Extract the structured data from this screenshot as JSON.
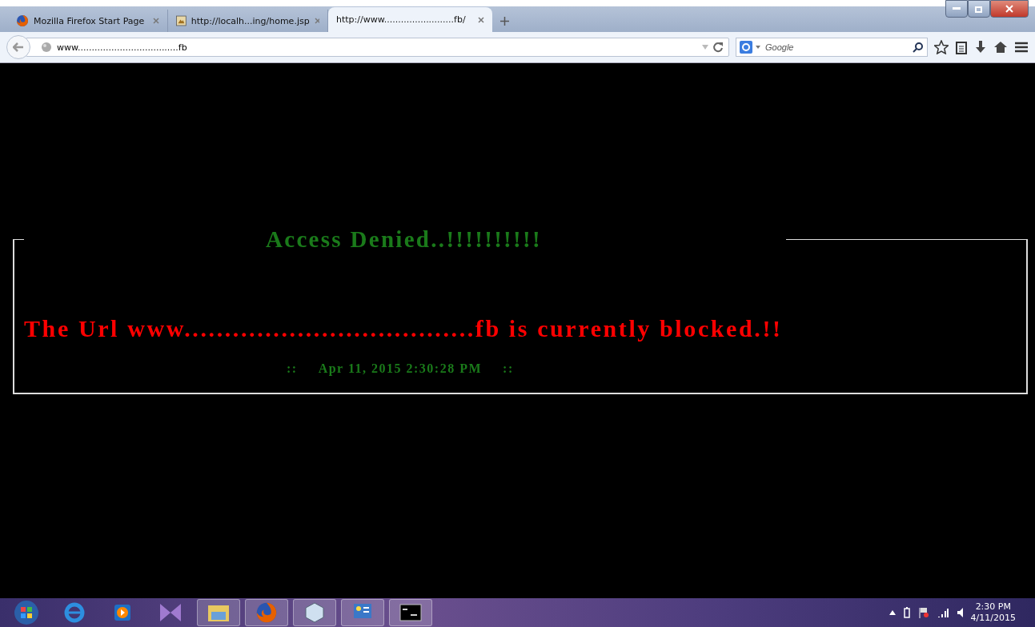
{
  "tabs": [
    {
      "label": "Mozilla Firefox Start Page",
      "kind": "firefox",
      "selected": false
    },
    {
      "label": "http://localh...ing/home.jsp",
      "kind": "page",
      "selected": false
    },
    {
      "label": "http://www.........................fb/",
      "kind": "none",
      "selected": true
    }
  ],
  "address": {
    "value": "www....................................fb"
  },
  "search": {
    "placeholder": "Google"
  },
  "page": {
    "title": "Access Denied..!!!!!!!!!!",
    "message": "The Url www....................................fb is currently blocked.!!",
    "separator_left": "::",
    "timestamp": "Apr 11, 2015 2:30:28 PM",
    "separator_right": "::"
  },
  "taskbar": {
    "time": "2:30 PM",
    "date": "4/11/2015"
  }
}
